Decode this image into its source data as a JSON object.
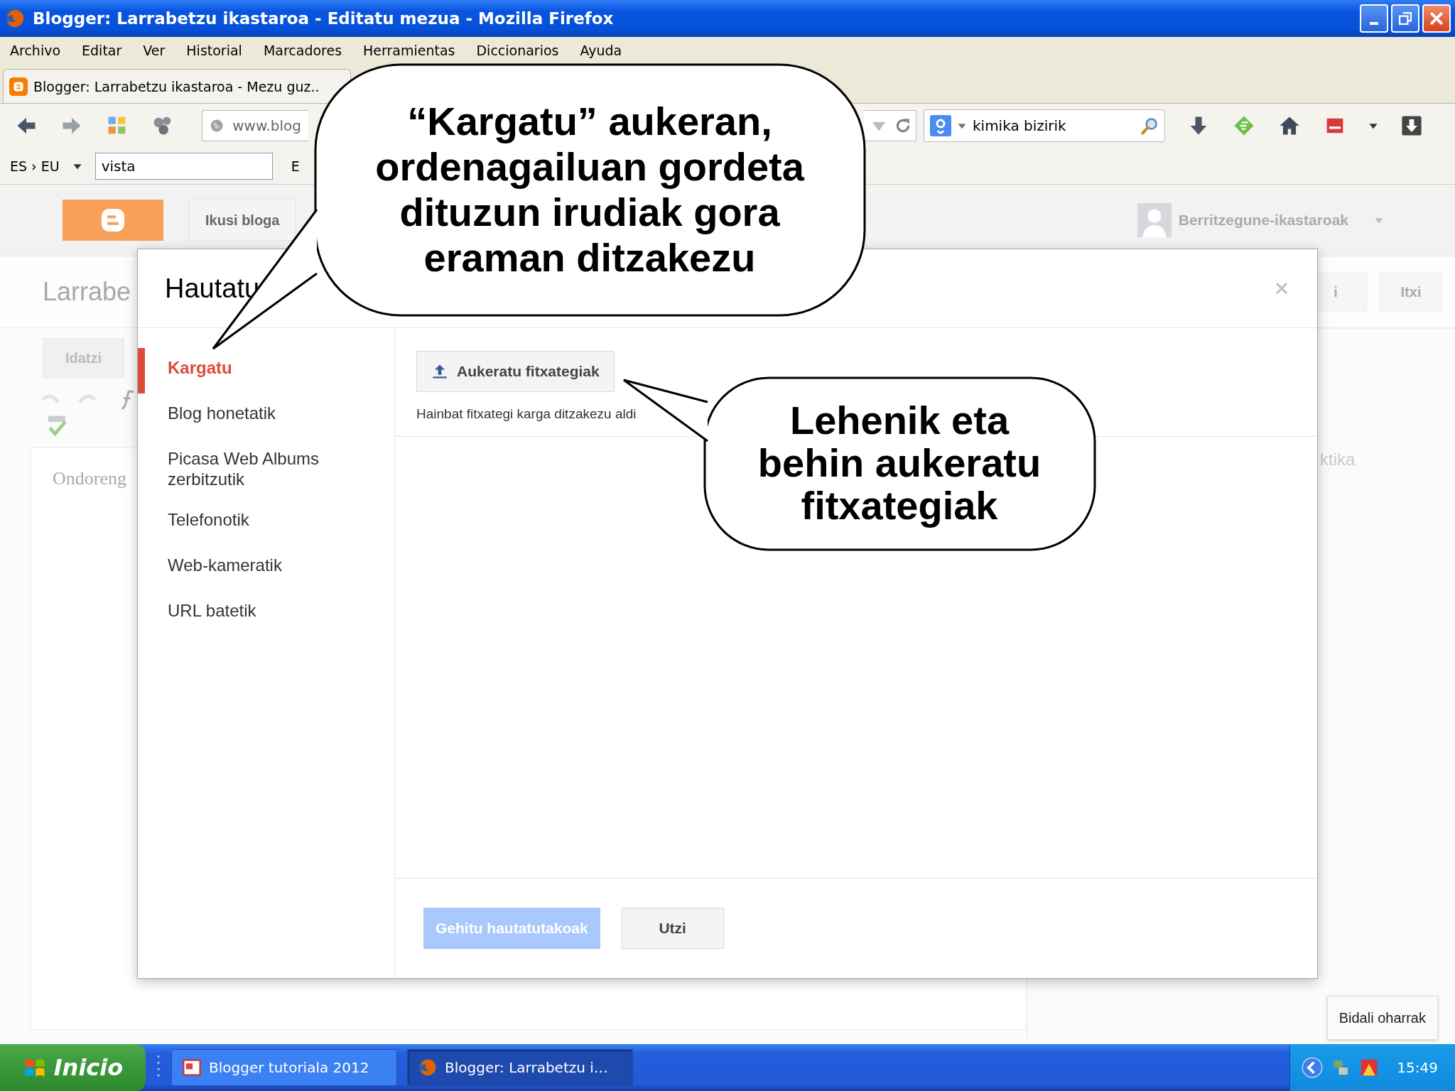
{
  "window": {
    "title": "Blogger: Larrabetzu ikastaroa - Editatu mezua - Mozilla Firefox"
  },
  "menu": [
    "Archivo",
    "Editar",
    "Ver",
    "Historial",
    "Marcadores",
    "Herramientas",
    "Diccionarios",
    "Ayuda"
  ],
  "tabs": [
    {
      "label": "Blogger: Larrabetzu ikastaroa - Mezu guz..",
      "selected": true
    }
  ],
  "toolbar": {
    "url": "www.blog",
    "search": "kimika bizirik"
  },
  "dictionary": {
    "languages": "ES › EU",
    "word": "vista",
    "button": "E"
  },
  "blogger": {
    "view_blog": "Ikusi bloga",
    "account": "Berritzegune-ikastaroak",
    "post_title": "Larrabe",
    "header_buttons": [
      "i",
      "Itxi"
    ],
    "mode_tab": "Idatzi",
    "editor_text": "Ondoreng",
    "sidebar_text": "ktika",
    "feedback": "Bidali oharrak"
  },
  "dialog": {
    "title": "Hautatu",
    "sources": [
      {
        "label": "Kargatu",
        "selected": true
      },
      {
        "label": "Blog honetatik",
        "selected": false
      },
      {
        "label": "Picasa Web Albums zerbitzutik",
        "selected": false
      },
      {
        "label": "Telefonotik",
        "selected": false
      },
      {
        "label": "Web-kameratik",
        "selected": false
      },
      {
        "label": "URL batetik",
        "selected": false
      }
    ],
    "choose_button": "Aukeratu fitxategiak",
    "hint": "Hainbat fitxategi karga ditzakezu aldi",
    "add_button": {
      "label": "Gehitu hautatutakoak",
      "disabled": true
    },
    "cancel_button": "Utzi"
  },
  "callouts": [
    {
      "text": "“Kargatu” aukeran, ordenagailuan gordeta dituzun irudiak gora eraman ditzakezu"
    },
    {
      "text": "Lehenik eta behin aukeratu fitxategiak"
    }
  ],
  "taskbar": {
    "start": "Inicio",
    "items": [
      {
        "label": "Blogger tutoriala 2012",
        "selected": false
      },
      {
        "label": "Blogger: Larrabetzu i…",
        "selected": true
      }
    ],
    "clock": "15:49"
  }
}
